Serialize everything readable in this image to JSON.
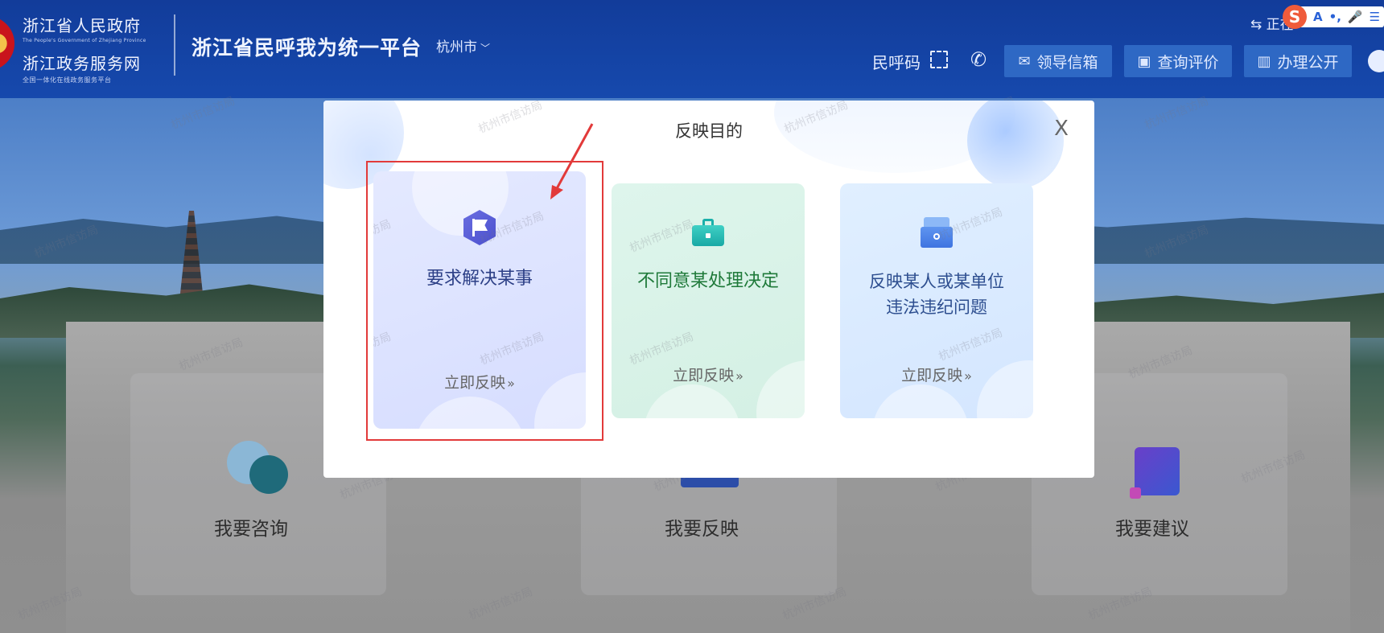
{
  "header": {
    "gov_name": "浙江省人民政府",
    "gov_name_en": "The People's Government of Zhejiang Province",
    "service_name": "浙江政务服务网",
    "service_sub": "全国一体化在线政务服务平台",
    "platform_title": "浙江省民呼我为统一平台",
    "city": "杭州市",
    "top_right_link": "⇆ 正在",
    "minhuma": "民呼码",
    "buttons": {
      "leader_mailbox": "领导信箱",
      "query_evaluate": "查询评价",
      "handle_public": "办理公开"
    },
    "ime": {
      "logo": "S",
      "items": [
        "A",
        "•,",
        "🎤",
        "☰"
      ]
    }
  },
  "services": {
    "consult": "我要咨询",
    "report": "我要反映",
    "suggest": "我要建议"
  },
  "watermark_text": "杭州市信访局",
  "modal": {
    "title": "反映目的",
    "close": "X",
    "options": [
      {
        "title": "要求解决某事",
        "link": "立即反映",
        "arrow": "»"
      },
      {
        "title": "不同意某处理决定",
        "link": "立即反映",
        "arrow": "»"
      },
      {
        "title_line1": "反映某人或某单位",
        "title_line2": "违法违纪问题",
        "link": "立即反映",
        "arrow": "»"
      }
    ]
  },
  "colors": {
    "header_bg": "#1649ad",
    "highlight": "#e23a3a",
    "opt1_text": "#2c3f86",
    "opt2_text": "#1f7a3a",
    "opt3_text": "#2d4e8f"
  },
  "icons": {
    "opt1": "flag-icon",
    "opt2": "briefcase-icon",
    "opt3": "mailbox-icon"
  }
}
